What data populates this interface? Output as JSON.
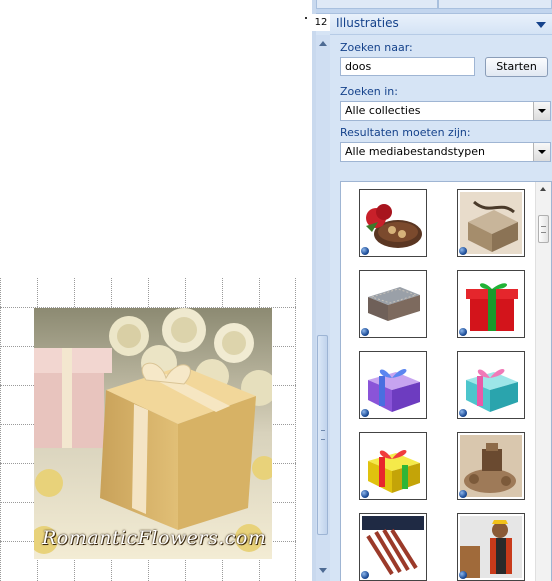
{
  "document": {
    "photo_watermark": "RomanticFlowers.com",
    "grid_lines": true
  },
  "task_pane": {
    "page_number": "12",
    "title": "Illustraties",
    "search_label": "Zoeken naar:",
    "search_value": "doos",
    "start_button": "Starten",
    "search_in_label": "Zoeken in:",
    "search_in_value": "Alle collecties",
    "results_type_label": "Resultaten moeten zijn:",
    "results_type_value": "Alle mediabestandstypen",
    "results": [
      {
        "name": "clip-chocolates-roses",
        "icon": "globe-icon"
      },
      {
        "name": "clip-gift-box-sepia",
        "icon": "globe-icon"
      },
      {
        "name": "clip-ornate-box",
        "icon": "globe-icon"
      },
      {
        "name": "clip-red-gift-box",
        "icon": "globe-icon"
      },
      {
        "name": "clip-purple-gift-box",
        "icon": "globe-icon"
      },
      {
        "name": "clip-teal-gift-box",
        "icon": "globe-icon"
      },
      {
        "name": "clip-yellow-gift-box",
        "icon": "globe-icon"
      },
      {
        "name": "clip-brown-gift",
        "icon": "globe-icon"
      },
      {
        "name": "clip-cinnamon-sticks",
        "icon": "globe-icon"
      },
      {
        "name": "clip-worker-with-box",
        "icon": "globe-icon"
      }
    ],
    "colors": {
      "pane_background": "#d6e4f5",
      "title_text": "#15428b",
      "label_text": "#15428b"
    }
  }
}
